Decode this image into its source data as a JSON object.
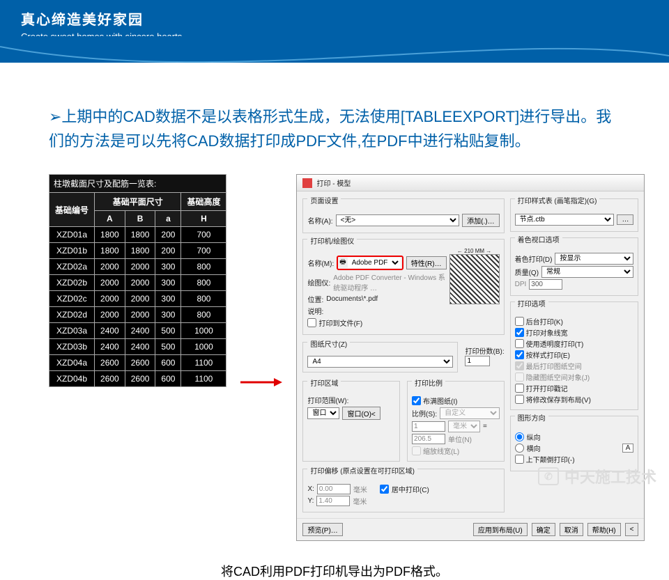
{
  "header": {
    "cn": "真心缔造美好家园",
    "en": "Create sweet homes with sincere hearts"
  },
  "main_text": "➢上期中的CAD数据不是以表格形式生成，无法使用[TABLEEXPORT]进行导出。我们的方法是可以先将CAD数据打印成PDF文件,在PDF中进行粘贴复制。",
  "cad_table": {
    "title": "柱墩截面尺寸及配筋一览表:",
    "head_group1": "基础编号",
    "head_group2": "基础平面尺寸",
    "head_group3": "基础高度",
    "cols": [
      "A",
      "B",
      "a",
      "H"
    ],
    "rows": [
      [
        "XZD01a",
        "1800",
        "1800",
        "200",
        "700"
      ],
      [
        "XZD01b",
        "1800",
        "1800",
        "200",
        "700"
      ],
      [
        "XZD02a",
        "2000",
        "2000",
        "300",
        "800"
      ],
      [
        "XZD02b",
        "2000",
        "2000",
        "300",
        "800"
      ],
      [
        "XZD02c",
        "2000",
        "2000",
        "300",
        "800"
      ],
      [
        "XZD02d",
        "2000",
        "2000",
        "300",
        "800"
      ],
      [
        "XZD03a",
        "2400",
        "2400",
        "500",
        "1000"
      ],
      [
        "XZD03b",
        "2400",
        "2400",
        "500",
        "1000"
      ],
      [
        "XZD04a",
        "2600",
        "2600",
        "600",
        "1100"
      ],
      [
        "XZD04b",
        "2600",
        "2600",
        "600",
        "1100"
      ]
    ]
  },
  "dialog": {
    "title": "打印 - 模型",
    "page_setup": "页面设置",
    "name_lbl": "名称(A):",
    "name_val": "<无>",
    "add_btn": "添加(.)…",
    "printer_group": "打印机/绘图仪",
    "printer_name_lbl": "名称(M):",
    "printer_name_val": "Adobe PDF",
    "props_btn": "特性(R)…",
    "plotter_lbl": "绘图仪:",
    "plotter_val": "Adobe PDF Converter - Windows 系统驱动程序 …",
    "where_lbl": "位置:",
    "where_val": "Documents\\*.pdf",
    "desc_lbl": "说明:",
    "tofile_cb": "打印到文件(F)",
    "paper_group": "图纸尺寸(Z)",
    "paper_val": "A4",
    "copies_lbl": "打印份数(B):",
    "copies_val": "1",
    "area_group": "打印区域",
    "area_lbl": "打印范围(W):",
    "area_val": "窗口",
    "window_btn": "窗口(O)<",
    "scale_group": "打印比例",
    "fit_cb": "布满图纸(I)",
    "scale_lbl": "比例(S):",
    "scale_val": "自定义",
    "unit_val": "毫米",
    "unit_num": "1",
    "drawing_unit": "206.5",
    "drawing_unit_lbl": "单位(N)",
    "lineweight_cb": "缩放线宽(L)",
    "offset_group": "打印偏移 (原点设置在可打印区域)",
    "x_lbl": "X:",
    "x_val": "0.00",
    "mm": "毫米",
    "center_cb": "居中打印(C)",
    "y_lbl": "Y:",
    "y_val": "1.40",
    "style_group": "打印样式表 (画笔指定)(G)",
    "style_val": "节点.ctb",
    "viewport_group": "着色视口选项",
    "shade_lbl": "着色打印(D)",
    "shade_val": "按显示",
    "quality_lbl": "质量(Q)",
    "quality_val": "常规",
    "dpi_lbl": "DPI",
    "dpi_val": "300",
    "options_group": "打印选项",
    "opt_bg": "后台打印(K)",
    "opt_obj": "打印对象线宽",
    "opt_trans": "使用透明度打印(T)",
    "opt_style": "按样式打印(E)",
    "opt_last": "最后打印图纸空间",
    "opt_hide": "隐藏图纸空间对象(J)",
    "opt_stamp": "打开打印戳记",
    "opt_save": "将修改保存到布局(V)",
    "orient_group": "图形方向",
    "orient_portrait": "纵向",
    "orient_landscape": "横向",
    "orient_upside": "上下颠倒打印(-)",
    "orient_A": "A",
    "preview_dim": "← 210 MM →",
    "foot_preview": "预览(P)…",
    "foot_apply": "应用到布局(U)",
    "foot_ok": "确定",
    "foot_cancel": "取消",
    "foot_help": "帮助(H)"
  },
  "caption": "将CAD利用PDF打印机导出为PDF格式。",
  "watermark": "中天施工技术"
}
